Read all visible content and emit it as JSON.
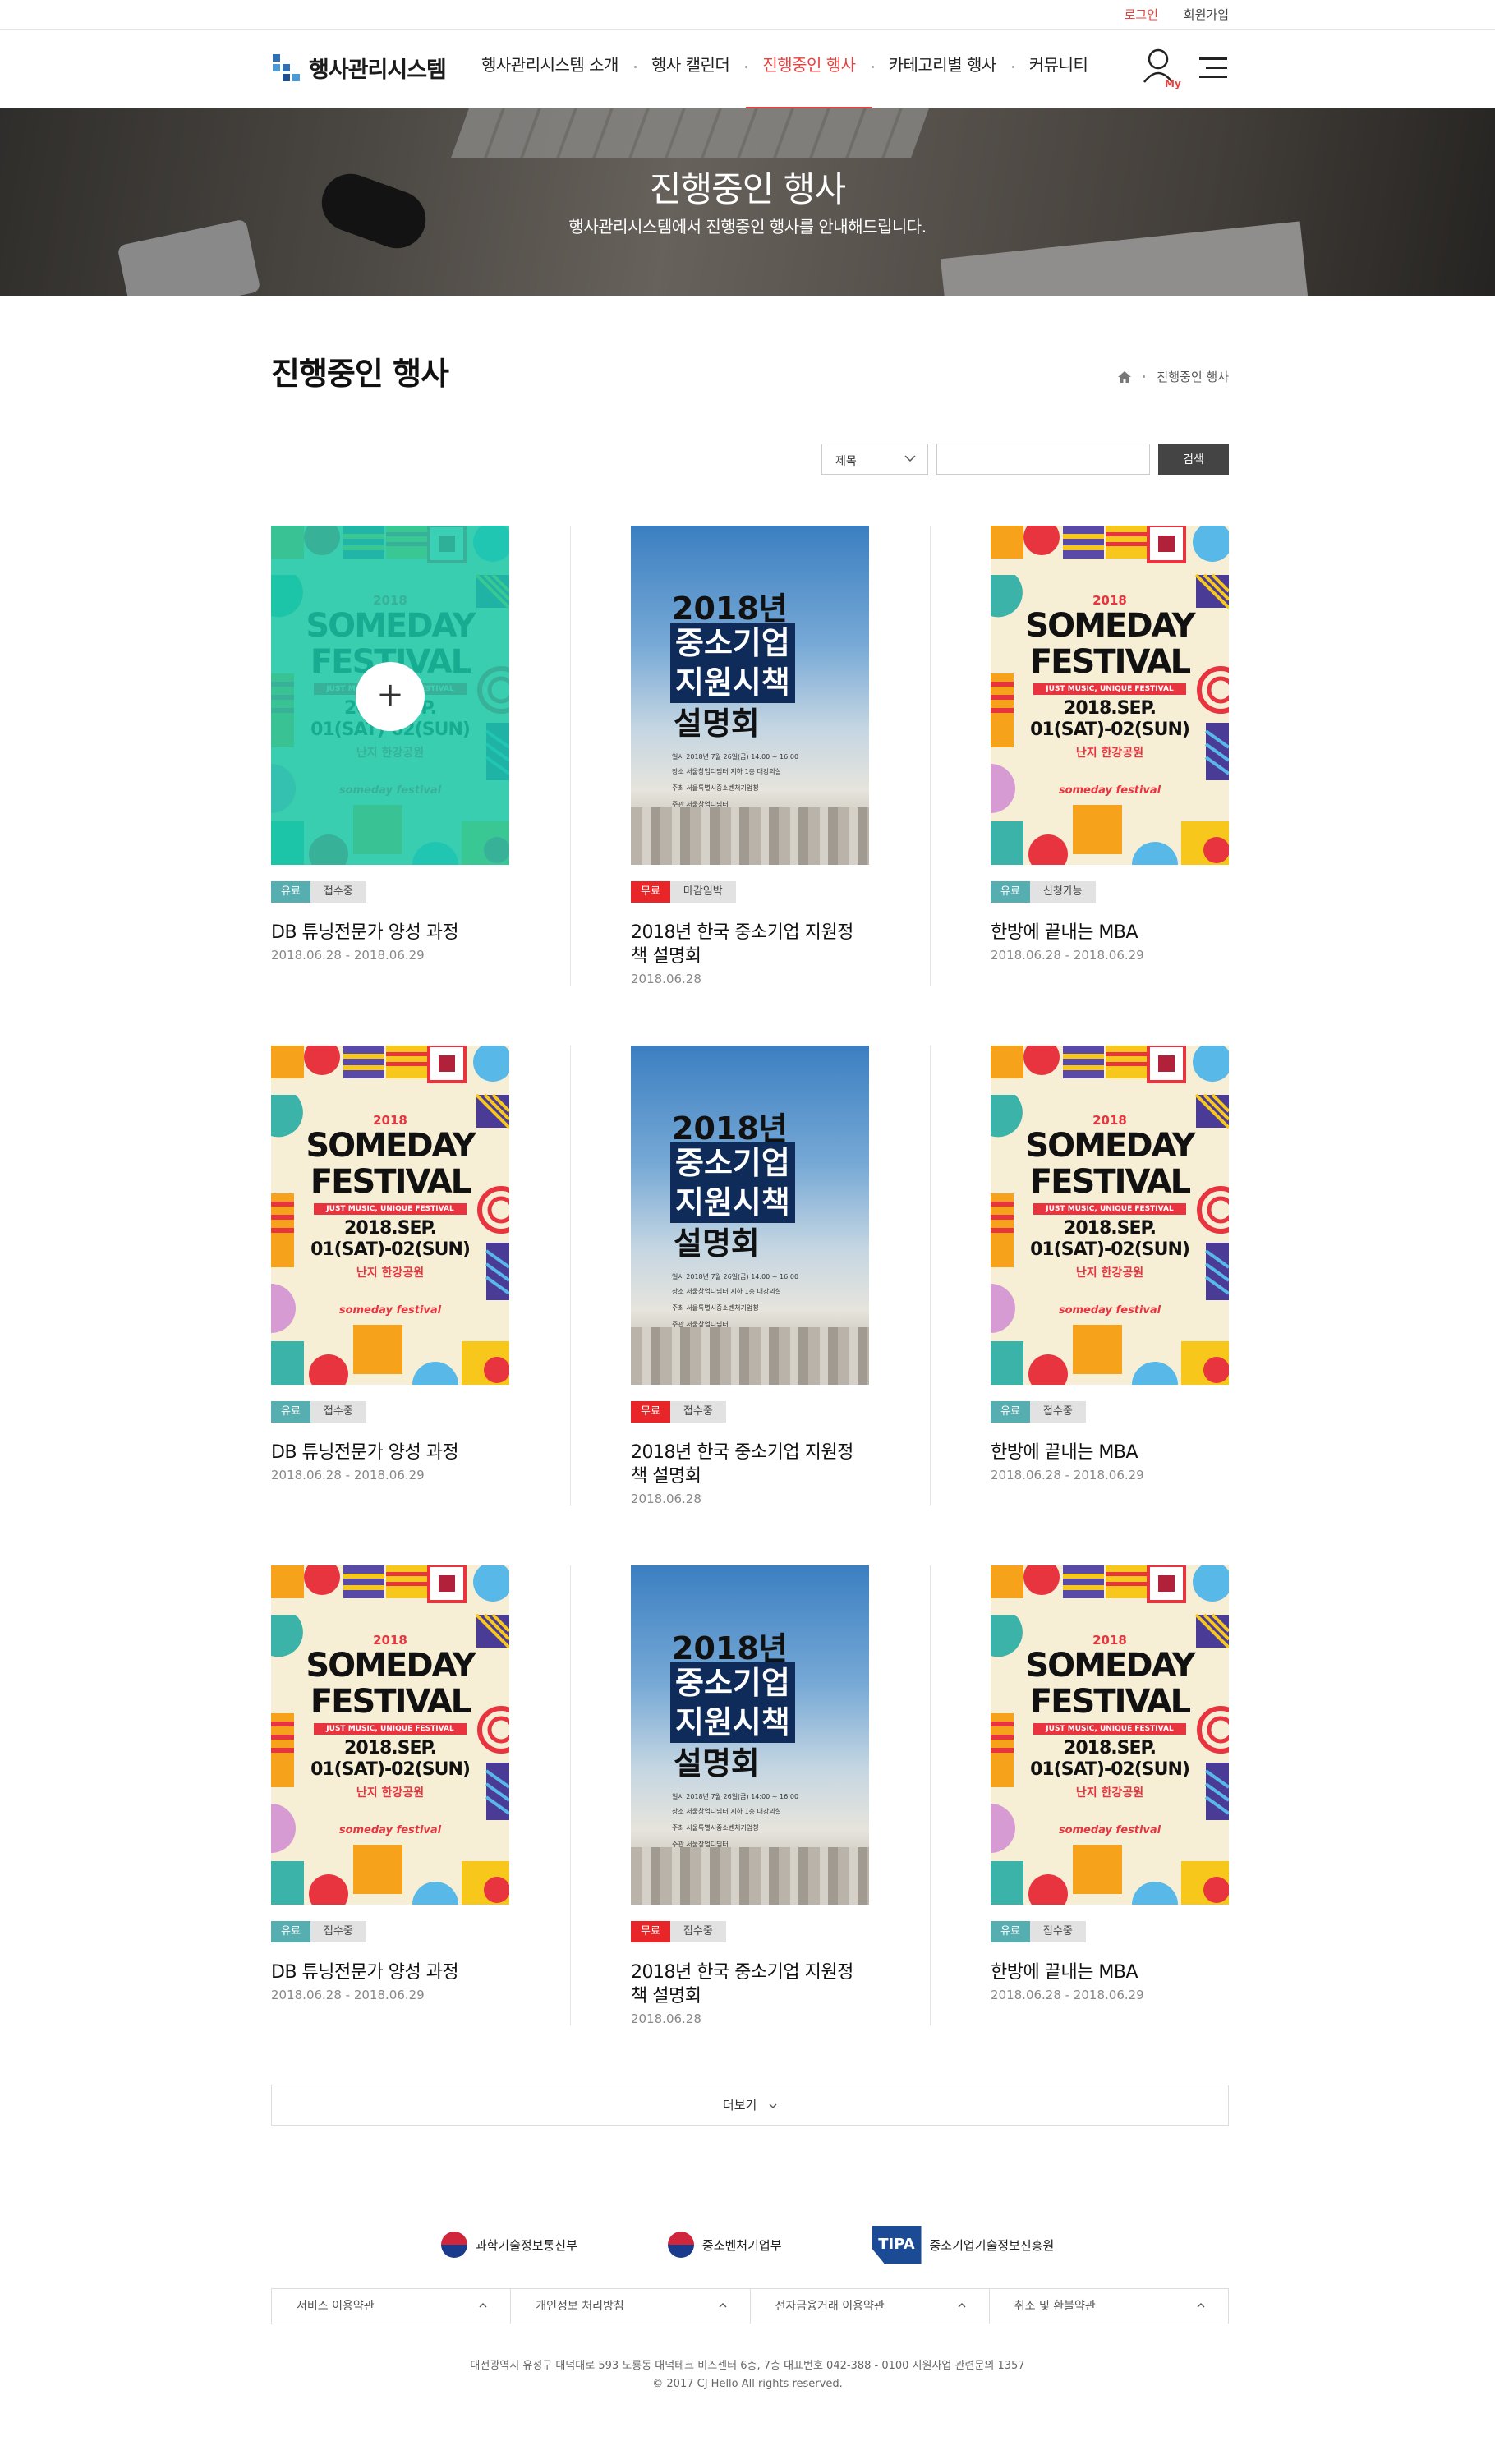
{
  "util": {
    "login": "로그인",
    "join": "회원가입"
  },
  "header": {
    "logo_text": "행사관리시스템",
    "nav": [
      {
        "label": "행사관리시스템 소개"
      },
      {
        "label": "행사 캘린더"
      },
      {
        "label": "진행중인 행사",
        "active": true
      },
      {
        "label": "카테고리별 행사"
      },
      {
        "label": "커뮤니티"
      }
    ],
    "my_label": "My"
  },
  "hero": {
    "title": "진행중인 행사",
    "subtitle": "행사관리시스템에서 진행중인 행사를 안내해드립니다."
  },
  "page": {
    "title": "진행중인 행사",
    "breadcrumb": "진행중인 행사"
  },
  "search": {
    "select_value": "제목",
    "button": "검색"
  },
  "events": [
    {
      "title": "DB 튜닝전문가 양성 과정",
      "date": "2018.06.28 - 2018.06.29",
      "fee": "유료",
      "status": "접수중",
      "poster": "fest",
      "hover": true
    },
    {
      "title": "2018년 한국 중소기업 지원정책 설명회",
      "date": "2018.06.28",
      "fee": "무료",
      "status": "마감임박",
      "poster": "sky"
    },
    {
      "title": "한방에 끝내는 MBA",
      "date": "2018.06.28 - 2018.06.29",
      "fee": "유료",
      "status": "신청가능",
      "poster": "fest"
    },
    {
      "title": "DB 튜닝전문가 양성 과정",
      "date": "2018.06.28 - 2018.06.29",
      "fee": "유료",
      "status": "접수중",
      "poster": "fest"
    },
    {
      "title": "2018년 한국 중소기업 지원정책 설명회",
      "date": "2018.06.28",
      "fee": "무료",
      "status": "접수중",
      "poster": "sky"
    },
    {
      "title": "한방에 끝내는 MBA",
      "date": "2018.06.28 - 2018.06.29",
      "fee": "유료",
      "status": "접수중",
      "poster": "fest"
    },
    {
      "title": "DB 튜닝전문가 양성 과정",
      "date": "2018.06.28 - 2018.06.29",
      "fee": "유료",
      "status": "접수중",
      "poster": "fest"
    },
    {
      "title": "2018년 한국 중소기업 지원정책 설명회",
      "date": "2018.06.28",
      "fee": "무료",
      "status": "접수중",
      "poster": "sky"
    },
    {
      "title": "한방에 끝내는 MBA",
      "date": "2018.06.28 - 2018.06.29",
      "fee": "유료",
      "status": "접수중",
      "poster": "fest"
    }
  ],
  "poster_text": {
    "fest": {
      "year": "2018",
      "line1": "SOMEDAY",
      "line2": "FESTIVAL",
      "tagline": "JUST MUSIC, UNIQUE FESTIVAL",
      "date1": "2018.SEP.",
      "date2": "01(SAT)-02(SUN)",
      "place": "난지 한강공원",
      "brand": "someday festival"
    },
    "sky": {
      "l1": "2018년",
      "l2": "중소기업",
      "l3": "지원시책",
      "l4": "설명회",
      "info1": "일시  2018년 7월 26일(금) 14:00 ~ 16:00",
      "info2": "장소  서울창업디딤터 지하 1층 대강의실",
      "info3": "주최  서울특별시중소벤처기업청",
      "info4": "주관  서울창업디딤터"
    }
  },
  "more": {
    "label": "더보기"
  },
  "footer": {
    "orgs": [
      "과학기술정보통신부",
      "중소벤처기업부",
      "중소기업기술정보진흥원"
    ],
    "tipa": "TIPA",
    "links": [
      "서비스 이용약관",
      "개인정보 처리방침",
      "전자금융거래 이용약관",
      "취소 및 환불약관"
    ],
    "address": "대전광역시 유성구 대덕대로 593 도룡동 대덕테크 비즈센터 6층, 7층  대표번호 042-388 - 0100  지원사업 관련문의 1357",
    "copyright": "© 2017 CJ Hello All rights reserved."
  },
  "colors": {
    "accent": "#e8413e",
    "teal_tag": "#56aeb1",
    "free_tag": "#e8262a"
  }
}
